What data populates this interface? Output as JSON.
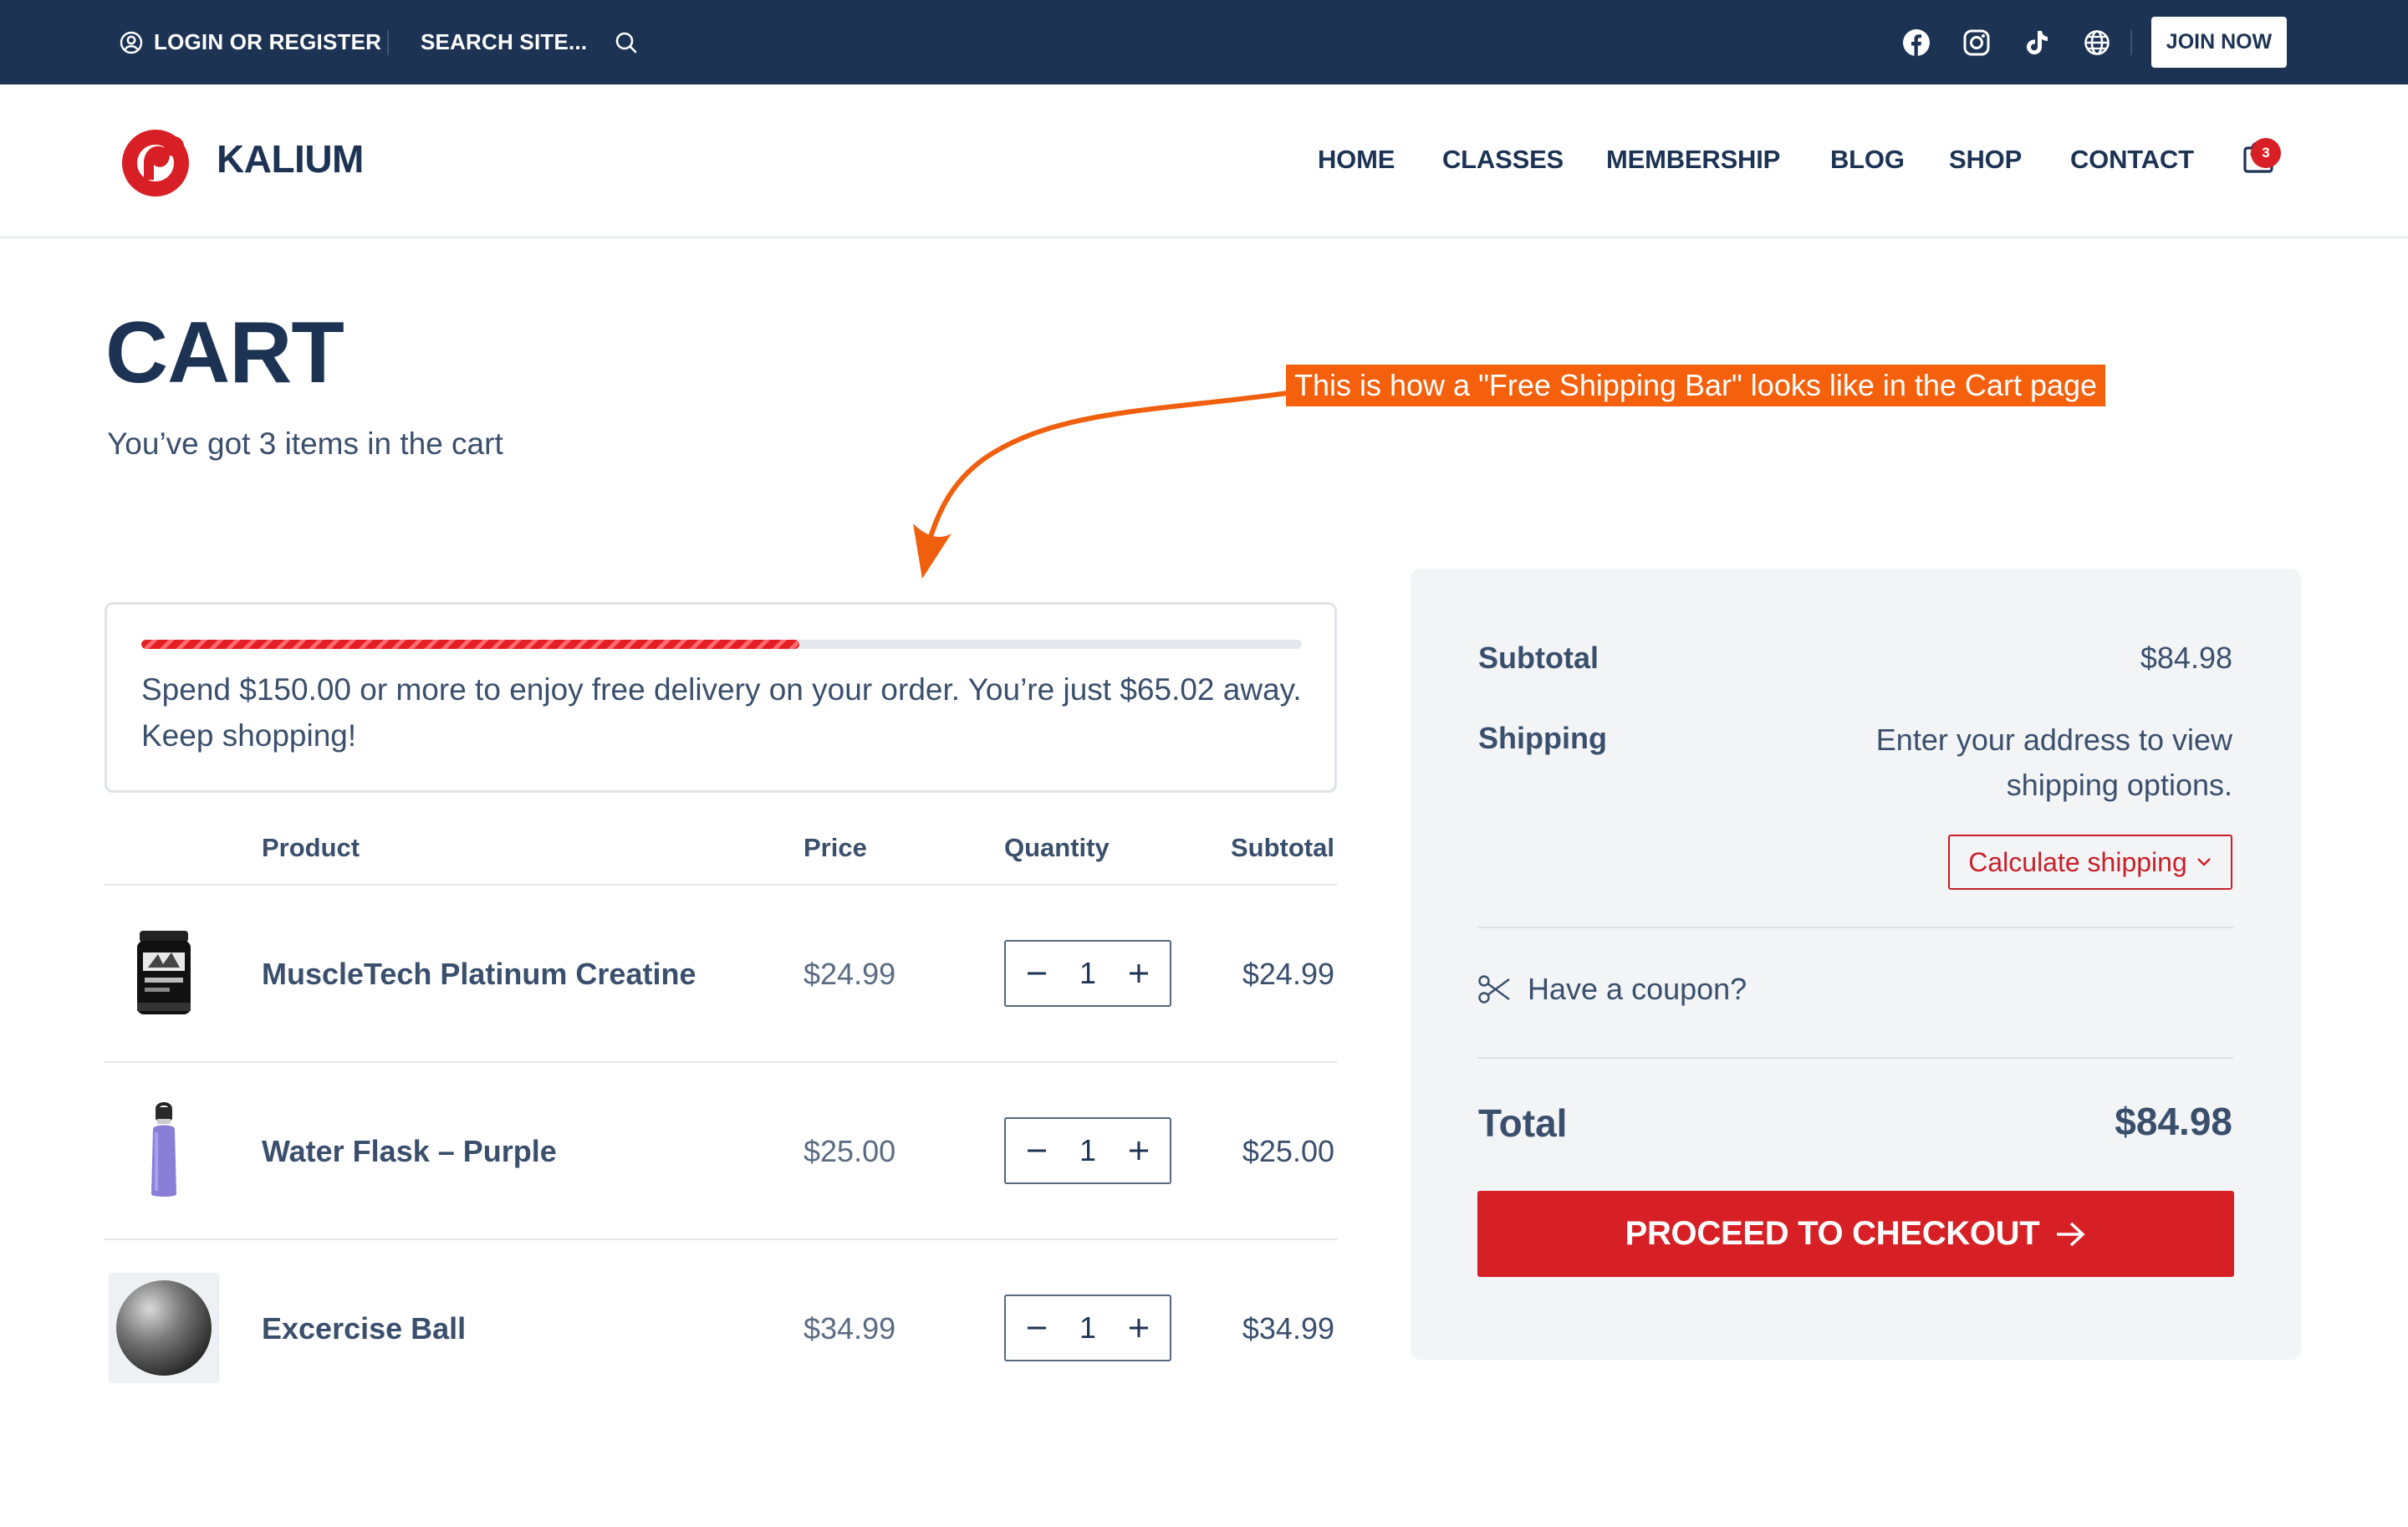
{
  "topbar": {
    "login_label": "LOGIN OR REGISTER",
    "search_label": "SEARCH SITE...",
    "join_label": "JOIN NOW",
    "social_icons": [
      "facebook-icon",
      "instagram-icon",
      "tiktok-icon",
      "globe-icon"
    ],
    "bg_color": "#1d3354"
  },
  "header": {
    "logo_text": "KALIUM",
    "nav": [
      "HOME",
      "CLASSES",
      "MEMBERSHIP",
      "BLOG",
      "SHOP",
      "CONTACT"
    ],
    "cart_count": "3",
    "brand_color": "#d91f26"
  },
  "page": {
    "title": "CART",
    "subtitle": "You’ve got 3 items in the cart"
  },
  "annotation": {
    "label": "This is how a \"Free Shipping Bar\" looks like in the Cart page"
  },
  "shipping_bar": {
    "progress_percent": 56.7,
    "message": "Spend $150.00 or more to enjoy free delivery on your order. You’re just $65.02 away. Keep shopping!"
  },
  "cart_table": {
    "headers": {
      "product": "Product",
      "price": "Price",
      "quantity": "Quantity",
      "subtotal": "Subtotal"
    },
    "items": [
      {
        "name": "MuscleTech Platinum Creatine",
        "price": "$24.99",
        "quantity": "1",
        "subtotal": "$24.99",
        "thumb": "creatine-jar-image"
      },
      {
        "name": "Water Flask – Purple",
        "price": "$25.00",
        "quantity": "1",
        "subtotal": "$25.00",
        "thumb": "water-flask-image"
      },
      {
        "name": "Excercise Ball",
        "price": "$34.99",
        "quantity": "1",
        "subtotal": "$34.99",
        "thumb": "exercise-ball-image"
      }
    ]
  },
  "totals": {
    "subtotal_label": "Subtotal",
    "subtotal_value": "$84.98",
    "shipping_label": "Shipping",
    "shipping_message": "Enter your address to view shipping options.",
    "calculate_label": "Calculate shipping",
    "coupon_label": "Have a coupon?",
    "total_label": "Total",
    "total_value": "$84.98",
    "checkout_label": "PROCEED TO CHECKOUT"
  }
}
